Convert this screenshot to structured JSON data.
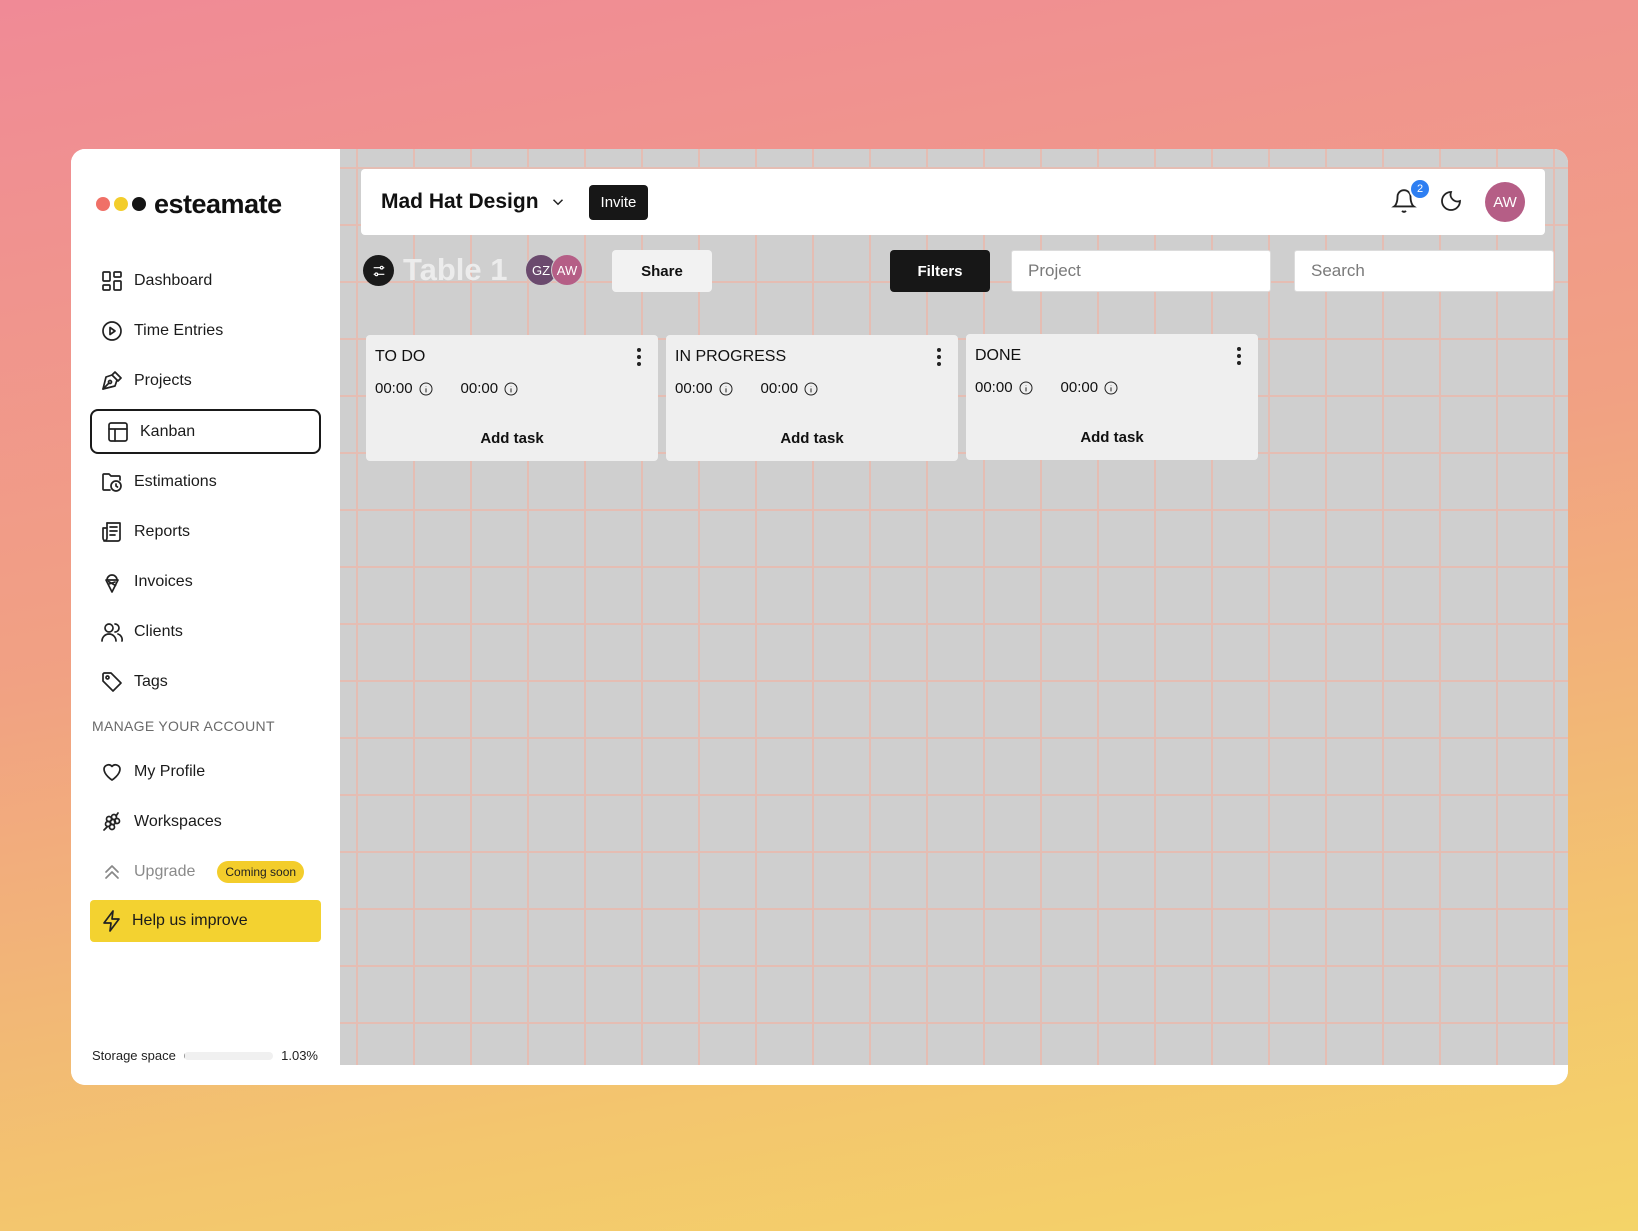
{
  "brand": {
    "name": "esteamate",
    "dot_colors": [
      "#f07067",
      "#f3cd2b",
      "#151515"
    ]
  },
  "sidebar": {
    "items": [
      {
        "label": "Dashboard",
        "icon": "dashboard-icon"
      },
      {
        "label": "Time Entries",
        "icon": "play-circle-icon"
      },
      {
        "label": "Projects",
        "icon": "pen-tool-icon"
      },
      {
        "label": "Kanban",
        "icon": "kanban-layout-icon",
        "active": true
      },
      {
        "label": "Estimations",
        "icon": "folder-clock-icon"
      },
      {
        "label": "Reports",
        "icon": "newspaper-icon"
      },
      {
        "label": "Invoices",
        "icon": "ice-cream-icon"
      },
      {
        "label": "Clients",
        "icon": "users-icon"
      },
      {
        "label": "Tags",
        "icon": "tag-icon"
      }
    ],
    "account_label": "MANAGE YOUR ACCOUNT",
    "account_items": [
      {
        "label": "My Profile",
        "icon": "heart-icon"
      },
      {
        "label": "Workspaces",
        "icon": "grapes-icon"
      }
    ],
    "upgrade": {
      "label": "Upgrade",
      "badge": "Coming soon"
    },
    "help_label": "Help us improve",
    "storage": {
      "label": "Storage space",
      "percent_text": "1.03%",
      "percent": 1.03
    }
  },
  "topbar": {
    "workspace": "Mad Hat Design",
    "invite_label": "Invite",
    "notification_count": "2",
    "avatar_initials": "AW"
  },
  "toolbar": {
    "table_title": "Table 1",
    "members": [
      {
        "initials": "GZ",
        "color": "#6b4a6e"
      },
      {
        "initials": "AW",
        "color": "#b55e86"
      }
    ],
    "share_label": "Share",
    "filters_label": "Filters",
    "project_placeholder": "Project",
    "search_placeholder": "Search"
  },
  "columns": [
    {
      "title": "TO DO",
      "time_a": "00:00",
      "time_b": "00:00",
      "add_label": "Add task"
    },
    {
      "title": "IN PROGRESS",
      "time_a": "00:00",
      "time_b": "00:00",
      "add_label": "Add task"
    },
    {
      "title": "DONE",
      "time_a": "00:00",
      "time_b": "00:00",
      "add_label": "Add task"
    }
  ],
  "colors": {
    "accent_yellow": "#f3d230",
    "notification_blue": "#2e7ff2",
    "avatar_pink": "#b55e86"
  }
}
